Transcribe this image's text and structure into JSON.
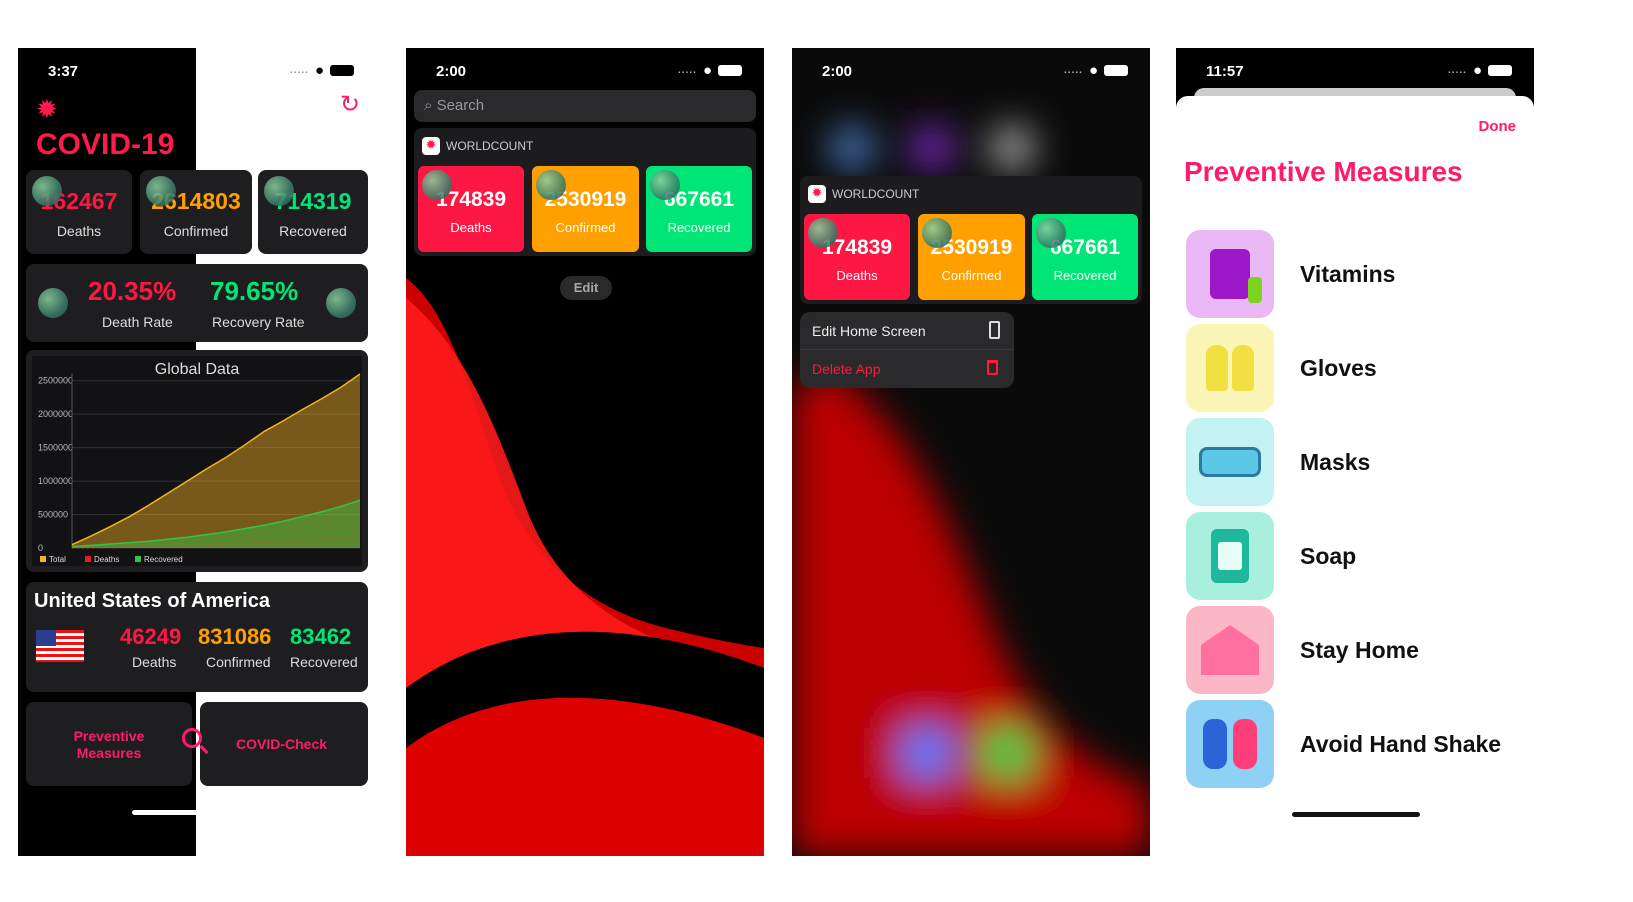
{
  "colors": {
    "red": "#ff1744",
    "orange": "#ffa000",
    "green": "#00e676",
    "pink": "#ff1a6b",
    "panel": "#1e1e20"
  },
  "screen1": {
    "status_time": "3:37",
    "title": "COVID-19",
    "global_stats": [
      {
        "value": "162467",
        "label": "Deaths",
        "color": "#ff1744"
      },
      {
        "value": "2614803",
        "label": "Confirmed",
        "color": "#ffa000"
      },
      {
        "value": "714319",
        "label": "Recovered",
        "color": "#00e676"
      }
    ],
    "rates": {
      "death_value": "20.35%",
      "death_label": "Death Rate",
      "recovery_value": "79.65%",
      "recovery_label": "Recovery Rate"
    },
    "chart_title": "Global Data",
    "country": {
      "name": "United States of America",
      "deaths": "46249",
      "deaths_label": "Deaths",
      "confirmed": "831086",
      "confirmed_label": "Confirmed",
      "recovered": "83462",
      "recovered_label": "Recovered"
    },
    "buttons": {
      "preventive": "Preventive Measures",
      "covid_check": "COVID-Check"
    }
  },
  "chart_data": {
    "type": "area",
    "title": "Global Data",
    "ylim": [
      0,
      2600000
    ],
    "yticks": [
      "0",
      "500000",
      "1000000",
      "1500000",
      "2000000",
      "2500000"
    ],
    "series": [
      {
        "name": "Total",
        "color": "#f5b323",
        "values": [
          50000,
          180000,
          320000,
          470000,
          640000,
          820000,
          1000000,
          1180000,
          1350000,
          1540000,
          1740000,
          1900000,
          2070000,
          2230000,
          2400000,
          2600000
        ]
      },
      {
        "name": "Deaths",
        "color": "#e02020",
        "values": [
          1000,
          3000,
          6000,
          10000,
          16000,
          24000,
          34000,
          46000,
          58000,
          72000,
          86000,
          100000,
          116000,
          132000,
          148000,
          162000
        ]
      },
      {
        "name": "Recovered",
        "color": "#36c24a",
        "values": [
          20000,
          40000,
          60000,
          80000,
          100000,
          130000,
          160000,
          200000,
          240000,
          290000,
          340000,
          400000,
          470000,
          540000,
          620000,
          714000
        ]
      }
    ],
    "legend": [
      "Total",
      "Deaths",
      "Recovered"
    ]
  },
  "screen2": {
    "status_time": "2:00",
    "search_placeholder": "Search",
    "widget_name": "WORLDCOUNT",
    "tiles": [
      {
        "value": "174839",
        "label": "Deaths",
        "color": "#ff1744"
      },
      {
        "value": "2530919",
        "label": "Confirmed",
        "color": "#ffa000"
      },
      {
        "value": "667661",
        "label": "Recovered",
        "color": "#00e676"
      }
    ],
    "edit_label": "Edit"
  },
  "screen3": {
    "status_time": "2:00",
    "widget_name": "WORLDCOUNT",
    "tiles": [
      {
        "value": "174839",
        "label": "Deaths",
        "color": "#ff1744"
      },
      {
        "value": "2530919",
        "label": "Confirmed",
        "color": "#ffa000"
      },
      {
        "value": "667661",
        "label": "Recovered",
        "color": "#00e676"
      }
    ],
    "menu": [
      {
        "label": "Edit Home Screen",
        "icon": "phone-icon"
      },
      {
        "label": "Delete App",
        "icon": "trash-icon"
      }
    ]
  },
  "screen4": {
    "status_time": "11:57",
    "done_label": "Done",
    "title": "Preventive Measures",
    "items": [
      {
        "label": "Vitamins",
        "bg": "#e9b8f5",
        "icon": "vitamins-icon"
      },
      {
        "label": "Gloves",
        "bg": "#fbf6b8",
        "icon": "gloves-icon"
      },
      {
        "label": "Masks",
        "bg": "#c4f1f2",
        "icon": "mask-icon"
      },
      {
        "label": "Soap",
        "bg": "#a8f0dd",
        "icon": "soap-icon"
      },
      {
        "label": "Stay Home",
        "bg": "#fbb7c6",
        "icon": "stay-home-icon"
      },
      {
        "label": "Avoid Hand Shake",
        "bg": "#8fd0f5",
        "icon": "handshake-icon"
      }
    ]
  }
}
